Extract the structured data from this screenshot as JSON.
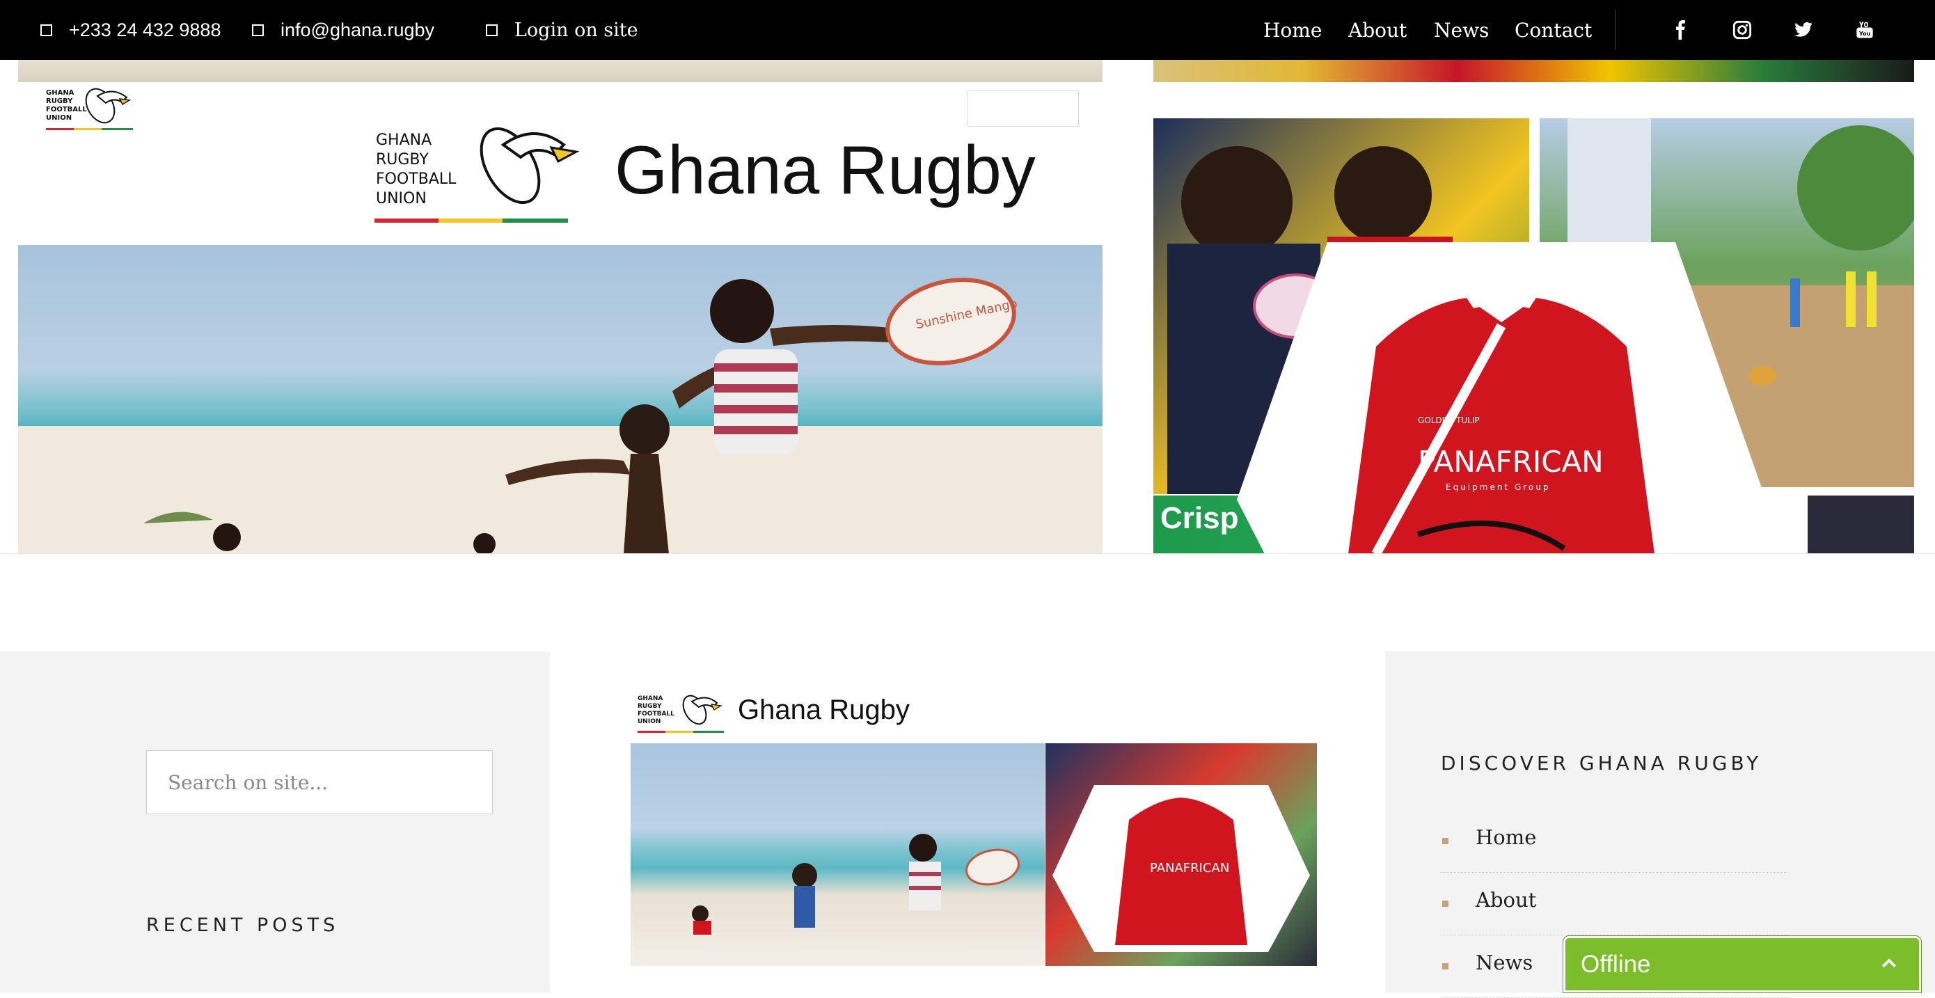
{
  "topbar": {
    "phone": "+233 24 432 9888",
    "email": "info@ghana.rugby",
    "login": "Login on site",
    "nav": [
      "Home",
      "About",
      "News",
      "Contact"
    ],
    "social": [
      "facebook-icon",
      "instagram-icon",
      "twitter-icon",
      "youtube-icon"
    ]
  },
  "hero": {
    "logo_small_lines": [
      "GHANA",
      "RUGBY",
      "FOOTBALL",
      "UNION"
    ],
    "logo_big_lines": [
      "GHANA",
      "RUGBY",
      "FOOTBALL",
      "UNION"
    ],
    "brand_title": "Ghana Rugby",
    "ball_text": "Sunshine Mango",
    "jersey_sponsor": "PANAFRICAN",
    "jersey_sub": "Equipment Group",
    "jersey_hotel": "GOLDEN TULIP",
    "crisps": "Crisp"
  },
  "sidebar_left": {
    "search_placeholder": "Search on site...",
    "recent_posts_title": "RECENT POSTS"
  },
  "featured": {
    "logo_lines": [
      "GHANA",
      "RUGBY",
      "FOOTBALL",
      "UNION"
    ],
    "title": "Ghana Rugby",
    "jersey_sponsor": "PANAFRICAN"
  },
  "sidebar_right": {
    "title": "DISCOVER GHANA RUGBY",
    "links": [
      "Home",
      "About",
      "News"
    ]
  },
  "chat": {
    "status": "Offline"
  },
  "colors": {
    "flag_red": "#d6252e",
    "flag_yellow": "#f2c521",
    "flag_green": "#1f8f46",
    "chat_green": "#7cbd2c",
    "bullet": "#c8a27a"
  }
}
